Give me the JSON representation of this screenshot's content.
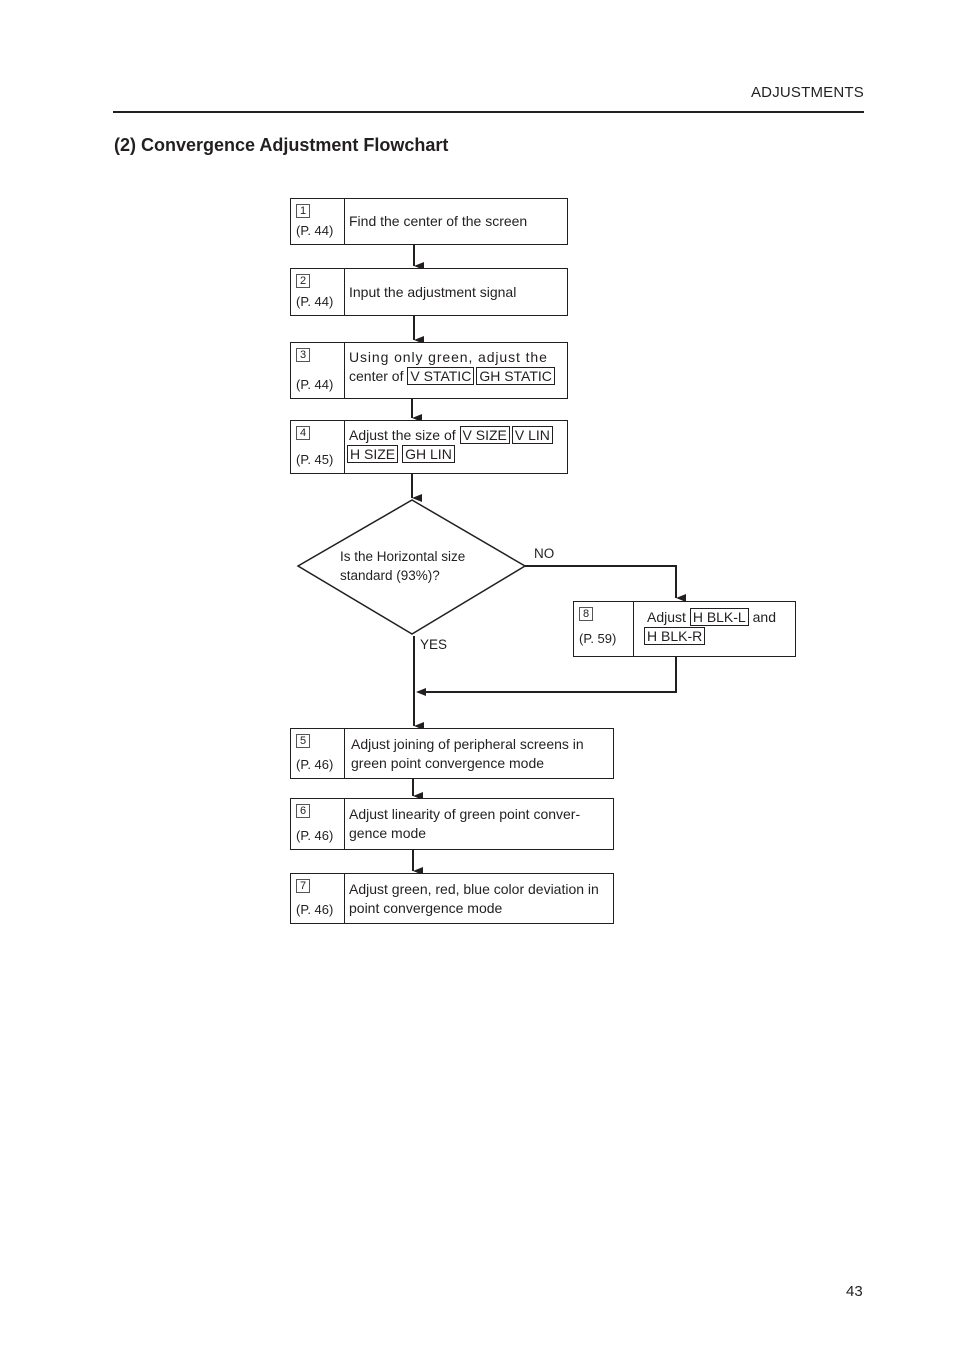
{
  "header": {
    "section": "ADJUSTMENTS"
  },
  "title": "(2) Convergence Adjustment Flowchart",
  "page_number": "43",
  "steps": [
    {
      "num": "1",
      "page": "(P. 44)",
      "text": "Find the center of the screen"
    },
    {
      "num": "2",
      "page": "(P. 44)",
      "text": "Input the adjustment signal"
    },
    {
      "num": "3",
      "page": "(P. 44)",
      "line1": "Using only green, adjust the",
      "line2_prefix": "center of",
      "tags": [
        "V STATIC",
        "GH STATIC"
      ]
    },
    {
      "num": "4",
      "page": "(P. 45)",
      "line1_prefix": "Adjust the size of",
      "tags": [
        "V SIZE",
        "V LIN",
        "H SIZE",
        "GH LIN"
      ]
    },
    {
      "num": "5",
      "page": "(P. 46)",
      "text": "Adjust joining of peripheral screens in green point convergence mode"
    },
    {
      "num": "6",
      "page": "(P. 46)",
      "text": "Adjust linearity of green point conver-gence mode"
    },
    {
      "num": "7",
      "page": "(P. 46)",
      "text": "Adjust green, red, blue color deviation in point convergence mode"
    },
    {
      "num": "8",
      "page": "(P. 59)",
      "prefix": "Adjust",
      "tags": [
        "H BLK-L",
        "H BLK-R"
      ],
      "joiner": "and"
    }
  ],
  "decision": {
    "text": "Is the Horizontal size standard (93%)?",
    "no_label": "NO",
    "yes_label": "YES"
  }
}
